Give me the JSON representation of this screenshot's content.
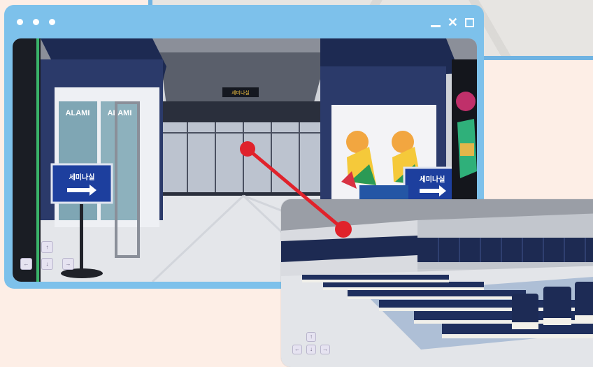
{
  "background_window": {},
  "main_window": {
    "title_dots": [
      "dot-red",
      "dot-yellow",
      "dot-green"
    ],
    "controls": {
      "minimize_icon": "minimize-icon",
      "close_icon": "close-icon",
      "maximize_icon": "maximize-icon"
    }
  },
  "lobby_scene": {
    "door_sign_text": "세미나실",
    "left_sign_text": "세미나실",
    "right_sign_text": "세미나실",
    "poster_text_1": "ALAMI",
    "poster_text_2": "ALAMI"
  },
  "movement_keys": {
    "up": "↑",
    "left": "←",
    "down": "↓",
    "right": "→"
  },
  "colors": {
    "window_blue": "#7dc1eb",
    "page_bg": "#fdeee6",
    "connector_red": "#e0222b",
    "navy": "#1d2a52"
  }
}
